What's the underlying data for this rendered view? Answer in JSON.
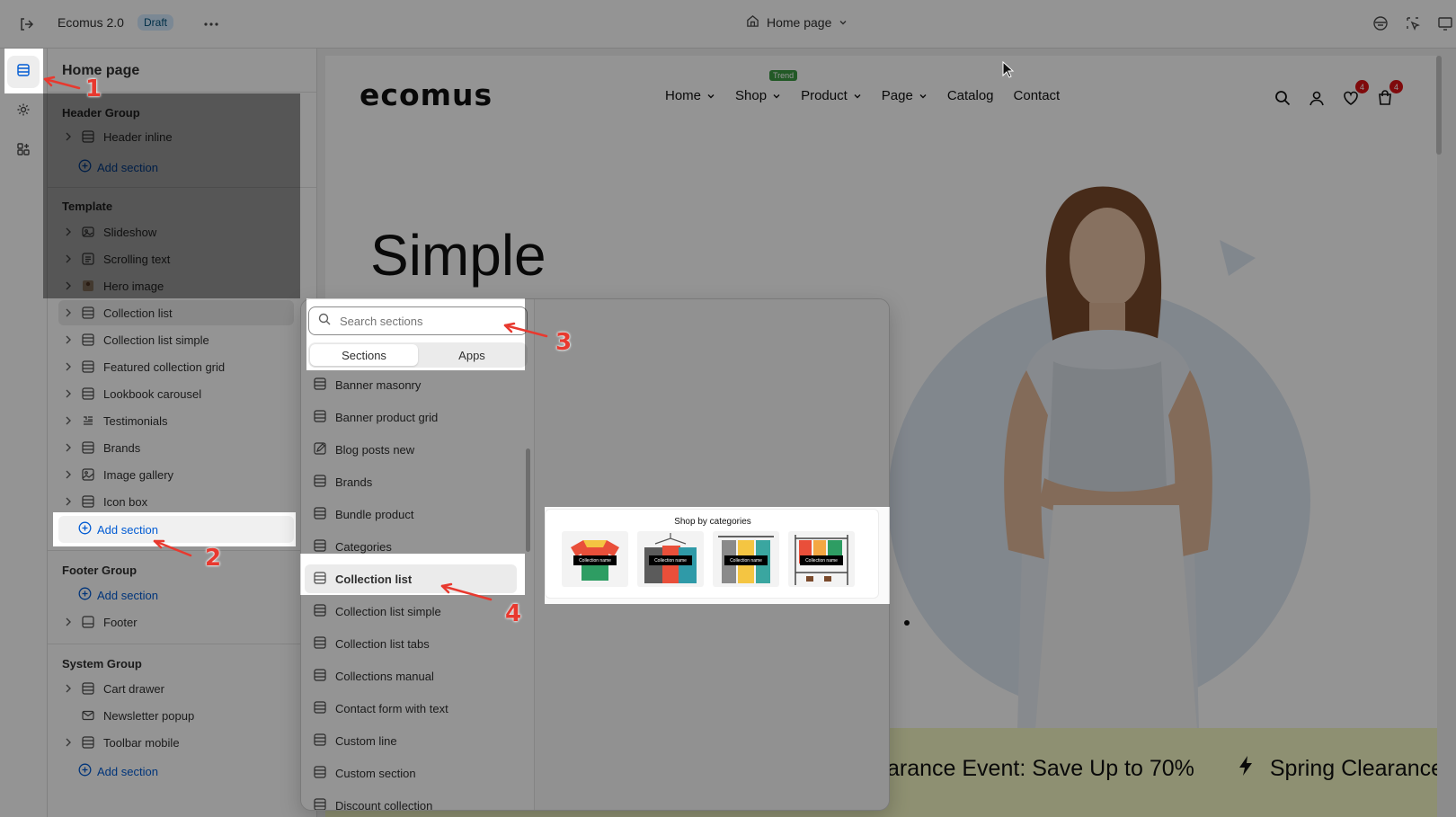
{
  "topbar": {
    "app_title": "Ecomus 2.0",
    "status_badge": "Draft",
    "page_selector": "Home page"
  },
  "sidebar": {
    "title": "Home page",
    "header_group": {
      "title": "Header Group",
      "items": [
        {
          "label": "Header inline",
          "icon": "section-icon"
        }
      ],
      "add_label": "Add section"
    },
    "template": {
      "title": "Template",
      "items": [
        {
          "label": "Slideshow",
          "icon": "slideshow-icon"
        },
        {
          "label": "Scrolling text",
          "icon": "text-icon"
        },
        {
          "label": "Hero image",
          "icon": "image-thumb-icon"
        },
        {
          "label": "Collection list",
          "icon": "section-icon",
          "selected": true
        },
        {
          "label": "Collection list simple",
          "icon": "section-icon"
        },
        {
          "label": "Featured collection grid",
          "icon": "section-icon"
        },
        {
          "label": "Lookbook carousel",
          "icon": "section-icon"
        },
        {
          "label": "Testimonials",
          "icon": "quote-icon"
        },
        {
          "label": "Brands",
          "icon": "section-icon"
        },
        {
          "label": "Image gallery",
          "icon": "image-icon"
        },
        {
          "label": "Icon box",
          "icon": "section-icon"
        }
      ],
      "add_label": "Add section"
    },
    "footer_group": {
      "title": "Footer Group",
      "add_label": "Add section",
      "items": [
        {
          "label": "Footer",
          "icon": "footer-icon"
        }
      ]
    },
    "system_group": {
      "title": "System Group",
      "items": [
        {
          "label": "Cart drawer",
          "icon": "section-icon"
        },
        {
          "label": "Newsletter popup",
          "icon": "mail-icon"
        },
        {
          "label": "Toolbar mobile",
          "icon": "section-icon"
        }
      ],
      "add_label": "Add section"
    }
  },
  "popup": {
    "search_placeholder": "Search sections",
    "tabs": [
      {
        "label": "Sections",
        "active": true
      },
      {
        "label": "Apps",
        "active": false
      }
    ],
    "items": [
      "Banner masonry",
      "Banner product grid",
      "Blog posts new",
      "Brands",
      "Bundle product",
      "Categories",
      "Collection list",
      "Collection list simple",
      "Collection list tabs",
      "Collections manual",
      "Contact form with text",
      "Custom line",
      "Custom section",
      "Discount collection"
    ],
    "highlighted_item": "Collection list",
    "preview": {
      "title": "Shop by categories",
      "tile_labels": [
        "Collection name",
        "Collection name",
        "Collection name",
        "Collection name"
      ]
    }
  },
  "storefront": {
    "logo": "ecomus",
    "nav": [
      "Home",
      "Shop",
      "Product",
      "Page",
      "Catalog",
      "Contact"
    ],
    "trend_badge": "Trend",
    "wishlist_count": "4",
    "cart_count": "4",
    "hero_title": "Simple",
    "marquee_text_1": "arance Event: Save Up to 70%",
    "marquee_text_2": "Spring Clearance E"
  },
  "annotations": [
    "1",
    "2",
    "3",
    "4"
  ],
  "colors": {
    "accent_link": "#005bd3",
    "badge_bg": "#d5ebff",
    "annotation": "#e8392f",
    "count_badge": "#db1215",
    "marquee_bg": "#f5f8c4"
  }
}
